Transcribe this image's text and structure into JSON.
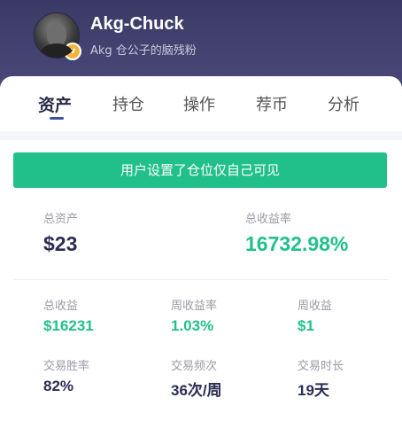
{
  "profile": {
    "username": "Akg-Chuck",
    "bio": "Akg 仓公子的脑残粉",
    "verified_glyph": "v"
  },
  "tabs": [
    {
      "label": "资产",
      "active": true
    },
    {
      "label": "持仓",
      "active": false
    },
    {
      "label": "操作",
      "active": false
    },
    {
      "label": "荐币",
      "active": false
    },
    {
      "label": "分析",
      "active": false
    }
  ],
  "notice": {
    "label": "用户设置了仓位仅自己可见"
  },
  "summary": {
    "total_assets_label": "总资产",
    "total_assets_value": "$23",
    "total_return_rate_label": "总收益率",
    "total_return_rate_value": "16732.98%"
  },
  "stats": [
    {
      "label": "总收益",
      "value": "$16231",
      "color": "green"
    },
    {
      "label": "周收益率",
      "value": "1.03%",
      "color": "green"
    },
    {
      "label": "周收益",
      "value": "$1",
      "color": "green"
    },
    {
      "label": "交易胜率",
      "value": "82%",
      "color": "dark"
    },
    {
      "label": "交易频次",
      "value": "36次/周",
      "color": "dark"
    },
    {
      "label": "交易时长",
      "value": "19天",
      "color": "dark"
    }
  ],
  "colors": {
    "header": "#3b3a66",
    "accent_green": "#21c08b",
    "dark_text": "#2c2c54",
    "tab_indicator": "#3f4fa8"
  }
}
